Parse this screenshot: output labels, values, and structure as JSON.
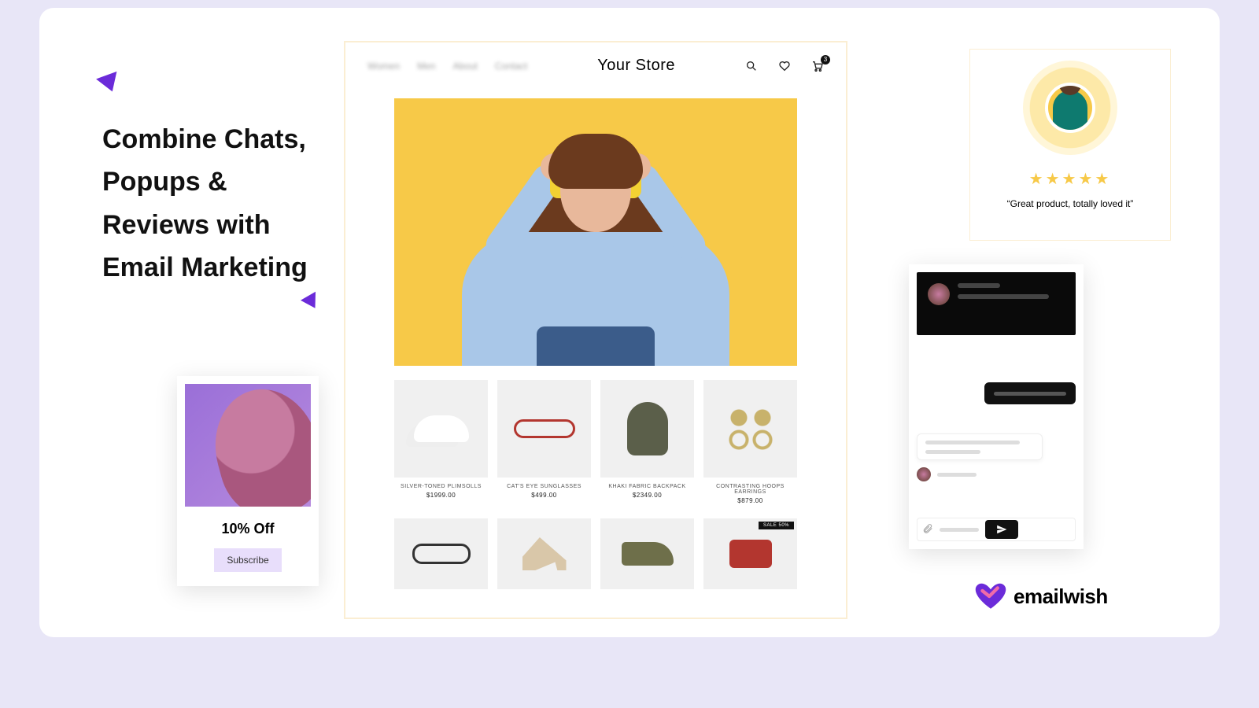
{
  "headline": "Combine Chats, Popups & Reviews with Email Marketing",
  "popup": {
    "title": "10% Off",
    "cta": "Subscribe"
  },
  "store": {
    "nav": [
      "Women",
      "Men",
      "About",
      "Contact"
    ],
    "title": "Your Store",
    "cart_count": "3",
    "products": [
      {
        "name": "SILVER-TONED PLIMSOLLS",
        "price": "$1999.00"
      },
      {
        "name": "CAT'S EYE SUNGLASSES",
        "price": "$499.00"
      },
      {
        "name": "KHAKI FABRIC BACKPACK",
        "price": "$2349.00"
      },
      {
        "name": "CONTRASTING HOOPS EARRINGS",
        "price": "$879.00"
      }
    ],
    "sale_badge": "SALE 50%"
  },
  "review": {
    "stars": "★★★★★",
    "quote": "“Great product, totally loved it”"
  },
  "brand": {
    "name": "emailwish"
  }
}
